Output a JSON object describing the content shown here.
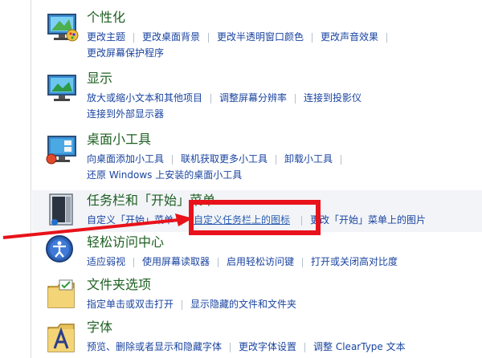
{
  "categories": [
    {
      "icon": "personalization-icon",
      "title": "个性化",
      "rows": [
        [
          "更改主题",
          "更改桌面背景",
          "更改半透明窗口颜色",
          "更改声音效果"
        ],
        [
          "更改屏幕保护程序"
        ]
      ]
    },
    {
      "icon": "display-icon",
      "title": "显示",
      "rows": [
        [
          "放大或缩小文本和其他项目",
          "调整屏幕分辨率",
          "连接到投影仪"
        ],
        [
          "连接到外部显示器"
        ]
      ]
    },
    {
      "icon": "desktop-gadgets-icon",
      "title": "桌面小工具",
      "rows": [
        [
          "向桌面添加小工具",
          "联机获取更多小工具",
          "卸载小工具"
        ],
        [
          "还原 Windows 上安装的桌面小工具"
        ]
      ]
    },
    {
      "icon": "taskbar-start-menu-icon",
      "title": "任务栏和「开始」菜单",
      "rows": [
        [
          "自定义「开始」菜单",
          "自定义任务栏上的图标",
          "更改「开始」菜单上的图片"
        ]
      ]
    },
    {
      "icon": "ease-of-access-icon",
      "title": "轻松访问中心",
      "rows": [
        [
          "适应弱视",
          "使用屏幕读取器",
          "启用轻松访问键",
          "打开或关闭高对比度"
        ]
      ]
    },
    {
      "icon": "folder-options-icon",
      "title": "文件夹选项",
      "rows": [
        [
          "指定单击或双击打开",
          "显示隐藏的文件和文件夹"
        ]
      ]
    },
    {
      "icon": "fonts-icon",
      "title": "字体",
      "rows": [
        [
          "预览、删除或者显示和隐藏字体",
          "更改字体设置",
          "调整 ClearType 文本"
        ]
      ]
    }
  ],
  "colors": {
    "title": "#1e5f22",
    "link": "#1a44a0",
    "highlight": "#e8121a"
  }
}
